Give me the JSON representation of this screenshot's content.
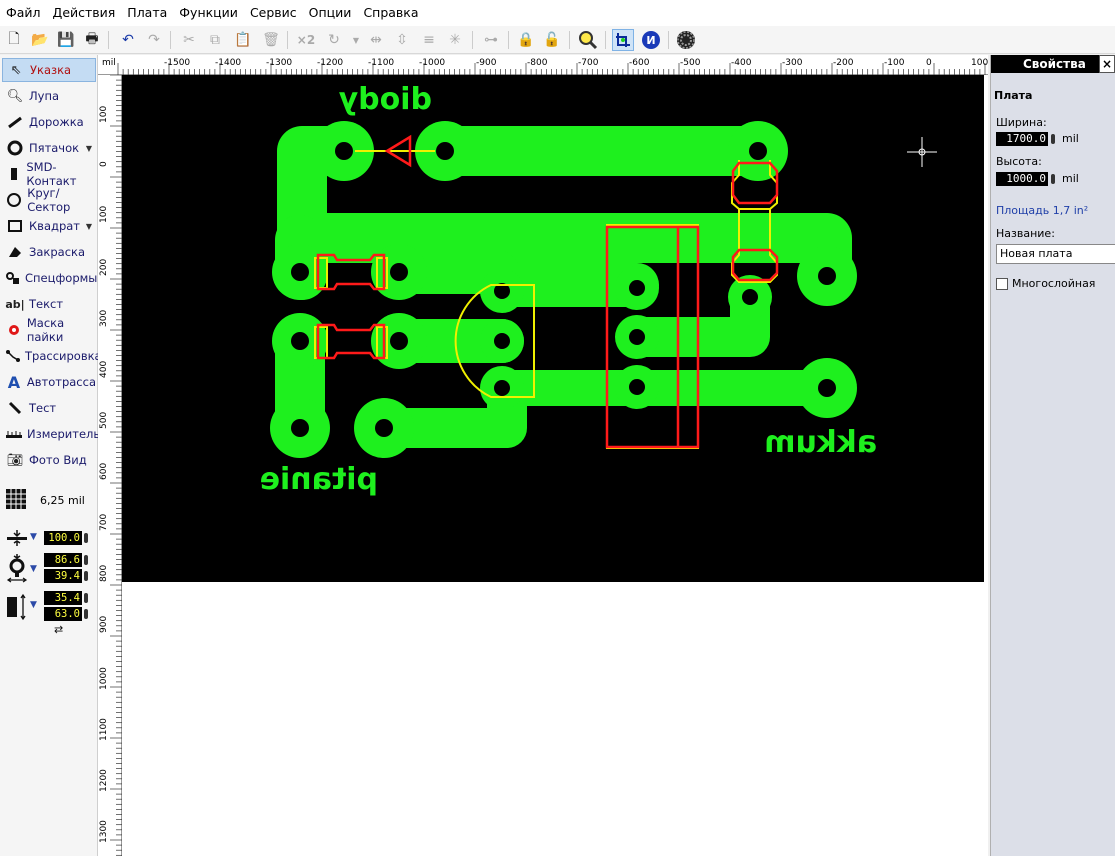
{
  "menu": [
    "Файл",
    "Действия",
    "Плата",
    "Функции",
    "Сервис",
    "Опции",
    "Справка"
  ],
  "toolbar": {
    "icons": [
      "new-file-icon",
      "open-folder-icon",
      "save-icon",
      "print-icon",
      "undo-icon",
      "redo-icon",
      "cut-icon",
      "copy-icon",
      "paste-icon",
      "delete-icon",
      "duplicate-icon",
      "rotate-icon",
      "mirror-h-icon",
      "mirror-v-icon",
      "align-icon",
      "group-icon",
      "snap-icon",
      "lock-icon",
      "unlock-icon",
      "zoom-icon",
      "grid-snap-icon",
      "info-icon",
      "component-icon"
    ],
    "duplicate_label": "×2"
  },
  "tools": [
    {
      "label": "Указка",
      "icon": "pointer-icon",
      "active": true
    },
    {
      "label": "Лупа",
      "icon": "magnifier-icon"
    },
    {
      "label": "Дорожка",
      "icon": "track-icon"
    },
    {
      "label": "Пятачок",
      "icon": "pad-icon",
      "dropdown": true
    },
    {
      "label": "SMD-Контакт",
      "icon": "smd-pad-icon"
    },
    {
      "label": "Круг/Сектор",
      "icon": "circle-icon"
    },
    {
      "label": "Квадрат",
      "icon": "square-icon",
      "dropdown": true
    },
    {
      "label": "Закраска",
      "icon": "fill-icon"
    },
    {
      "label": "Спецформы",
      "icon": "special-shapes-icon"
    },
    {
      "label": "Текст",
      "icon": "text-icon"
    },
    {
      "label": "Маска пайки",
      "icon": "solder-mask-icon"
    },
    {
      "label": "Трассировка",
      "icon": "routing-icon"
    },
    {
      "label": "Автотрасса",
      "icon": "autoroute-icon"
    },
    {
      "label": "Тест",
      "icon": "test-icon"
    },
    {
      "label": "Измеритель",
      "icon": "ruler-icon"
    },
    {
      "label": "Фото Вид",
      "icon": "camera-icon"
    }
  ],
  "grid": {
    "value": "6,25 mil",
    "icon": "grid-icon"
  },
  "params": {
    "track_width": "100.0",
    "pad_outer": "86.6",
    "pad_inner": "39.4",
    "smd_width": "35.4",
    "smd_height": "63.0"
  },
  "ruler": {
    "unit": "mil",
    "top_ticks": [
      "-1500",
      "-1400",
      "-1300",
      "-1200",
      "-1100",
      "-1000",
      "-900",
      "-800",
      "-700",
      "-600",
      "-500",
      "-400",
      "-300",
      "-200",
      "-100",
      "0",
      "100"
    ],
    "left_ticks": [
      "100",
      "0",
      "100",
      "200",
      "300",
      "400",
      "500",
      "600",
      "700",
      "800",
      "900",
      "1000",
      "1100",
      "1200",
      "1300"
    ]
  },
  "board": {
    "labels": {
      "diody": "diody",
      "pitanie": "pitanie",
      "akkum": "akkum"
    },
    "colors": {
      "copper": "#1ef01e",
      "silk": "#f0f000",
      "outline": "#ff1a1a",
      "background": "#000000"
    }
  },
  "properties": {
    "title": "Свойства",
    "close": "×",
    "section": "Плата",
    "width_label": "Ширина:",
    "width_value": "1700.0",
    "height_label": "Высота:",
    "height_value": "1000.0",
    "unit": "mil",
    "area": "Площадь  1,7 in²",
    "name_label": "Название:",
    "name_value": "Новая плата",
    "multilayer_label": "Многослойная"
  }
}
